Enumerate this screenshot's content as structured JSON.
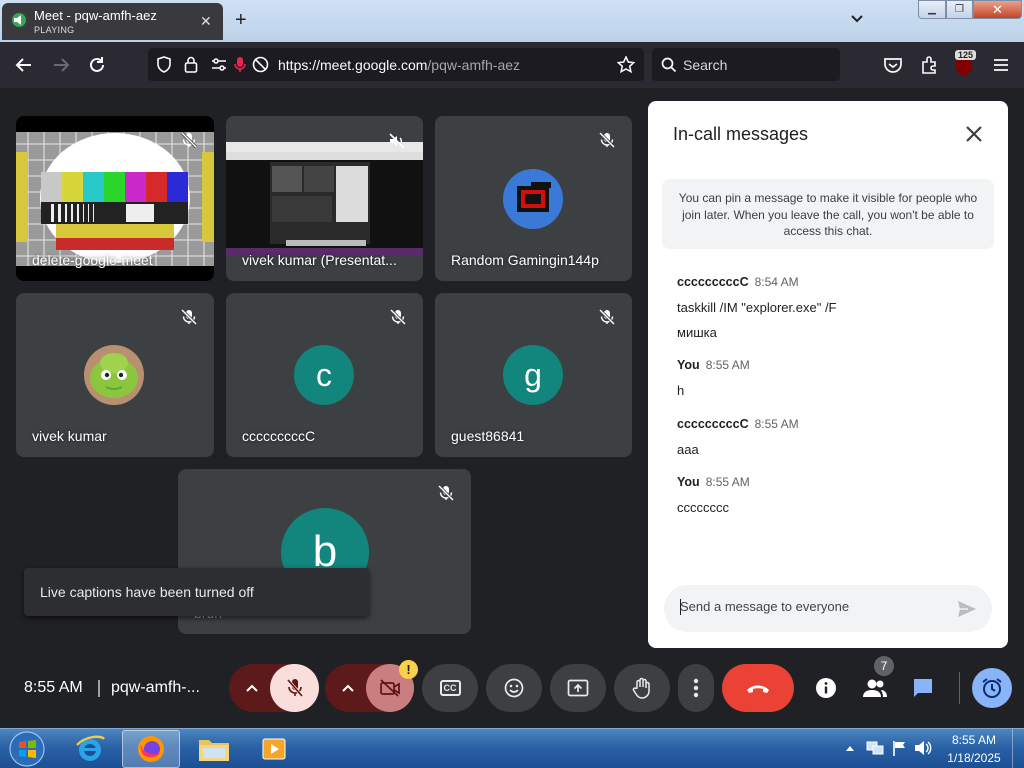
{
  "browser": {
    "tab_title": "Meet - pqw-amfh-aez",
    "tab_status": "PLAYING",
    "url_host": "https://meet.google.com",
    "url_path": "/pqw-amfh-aez",
    "search_placeholder": "Search",
    "extension_badge": "125"
  },
  "meet": {
    "tiles": [
      {
        "name": "delete-google-meet"
      },
      {
        "name": "vivek kumar (Presentat..."
      },
      {
        "name": "Random Gamingin144p"
      },
      {
        "name": "vivek kumar"
      },
      {
        "name": "cccccccccC",
        "avatar_letter": "c"
      },
      {
        "name": "guest86841",
        "avatar_letter": "g"
      },
      {
        "name": "bruh",
        "avatar_letter": "b"
      }
    ],
    "toast": "Live captions have been turned off",
    "clock": "8:55 AM",
    "meeting_code": "pqw-amfh-...",
    "warning_badge": "!",
    "participant_count": "7",
    "cc_label": "CC"
  },
  "chat": {
    "title": "In-call messages",
    "pin_note": "You can pin a message to make it visible for people who join later. When you leave the call, you won't be able to access this chat.",
    "messages": [
      {
        "sender": "cccccccccC",
        "time": "8:54 AM",
        "lines": [
          "taskkill /IM \"explorer.exe\" /F",
          "мишка"
        ]
      },
      {
        "sender": "You",
        "time": "8:55 AM",
        "lines": [
          "h"
        ]
      },
      {
        "sender": "cccccccccC",
        "time": "8:55 AM",
        "lines": [
          "aaa"
        ]
      },
      {
        "sender": "You",
        "time": "8:55 AM",
        "lines": [
          "cccccccc"
        ]
      }
    ],
    "input_placeholder": "Send a message to everyone"
  },
  "taskbar": {
    "time": "8:55 AM",
    "date": "1/18/2025"
  },
  "colors": {
    "meet_bg": "#202124",
    "tile_bg": "#3c4043",
    "avatar_teal": "#12857c",
    "hangup_red": "#ea4335",
    "muted_dark_red": "#5c1a1a",
    "muted_light": "#f9dedc",
    "active_blue": "#8ab4f8"
  }
}
